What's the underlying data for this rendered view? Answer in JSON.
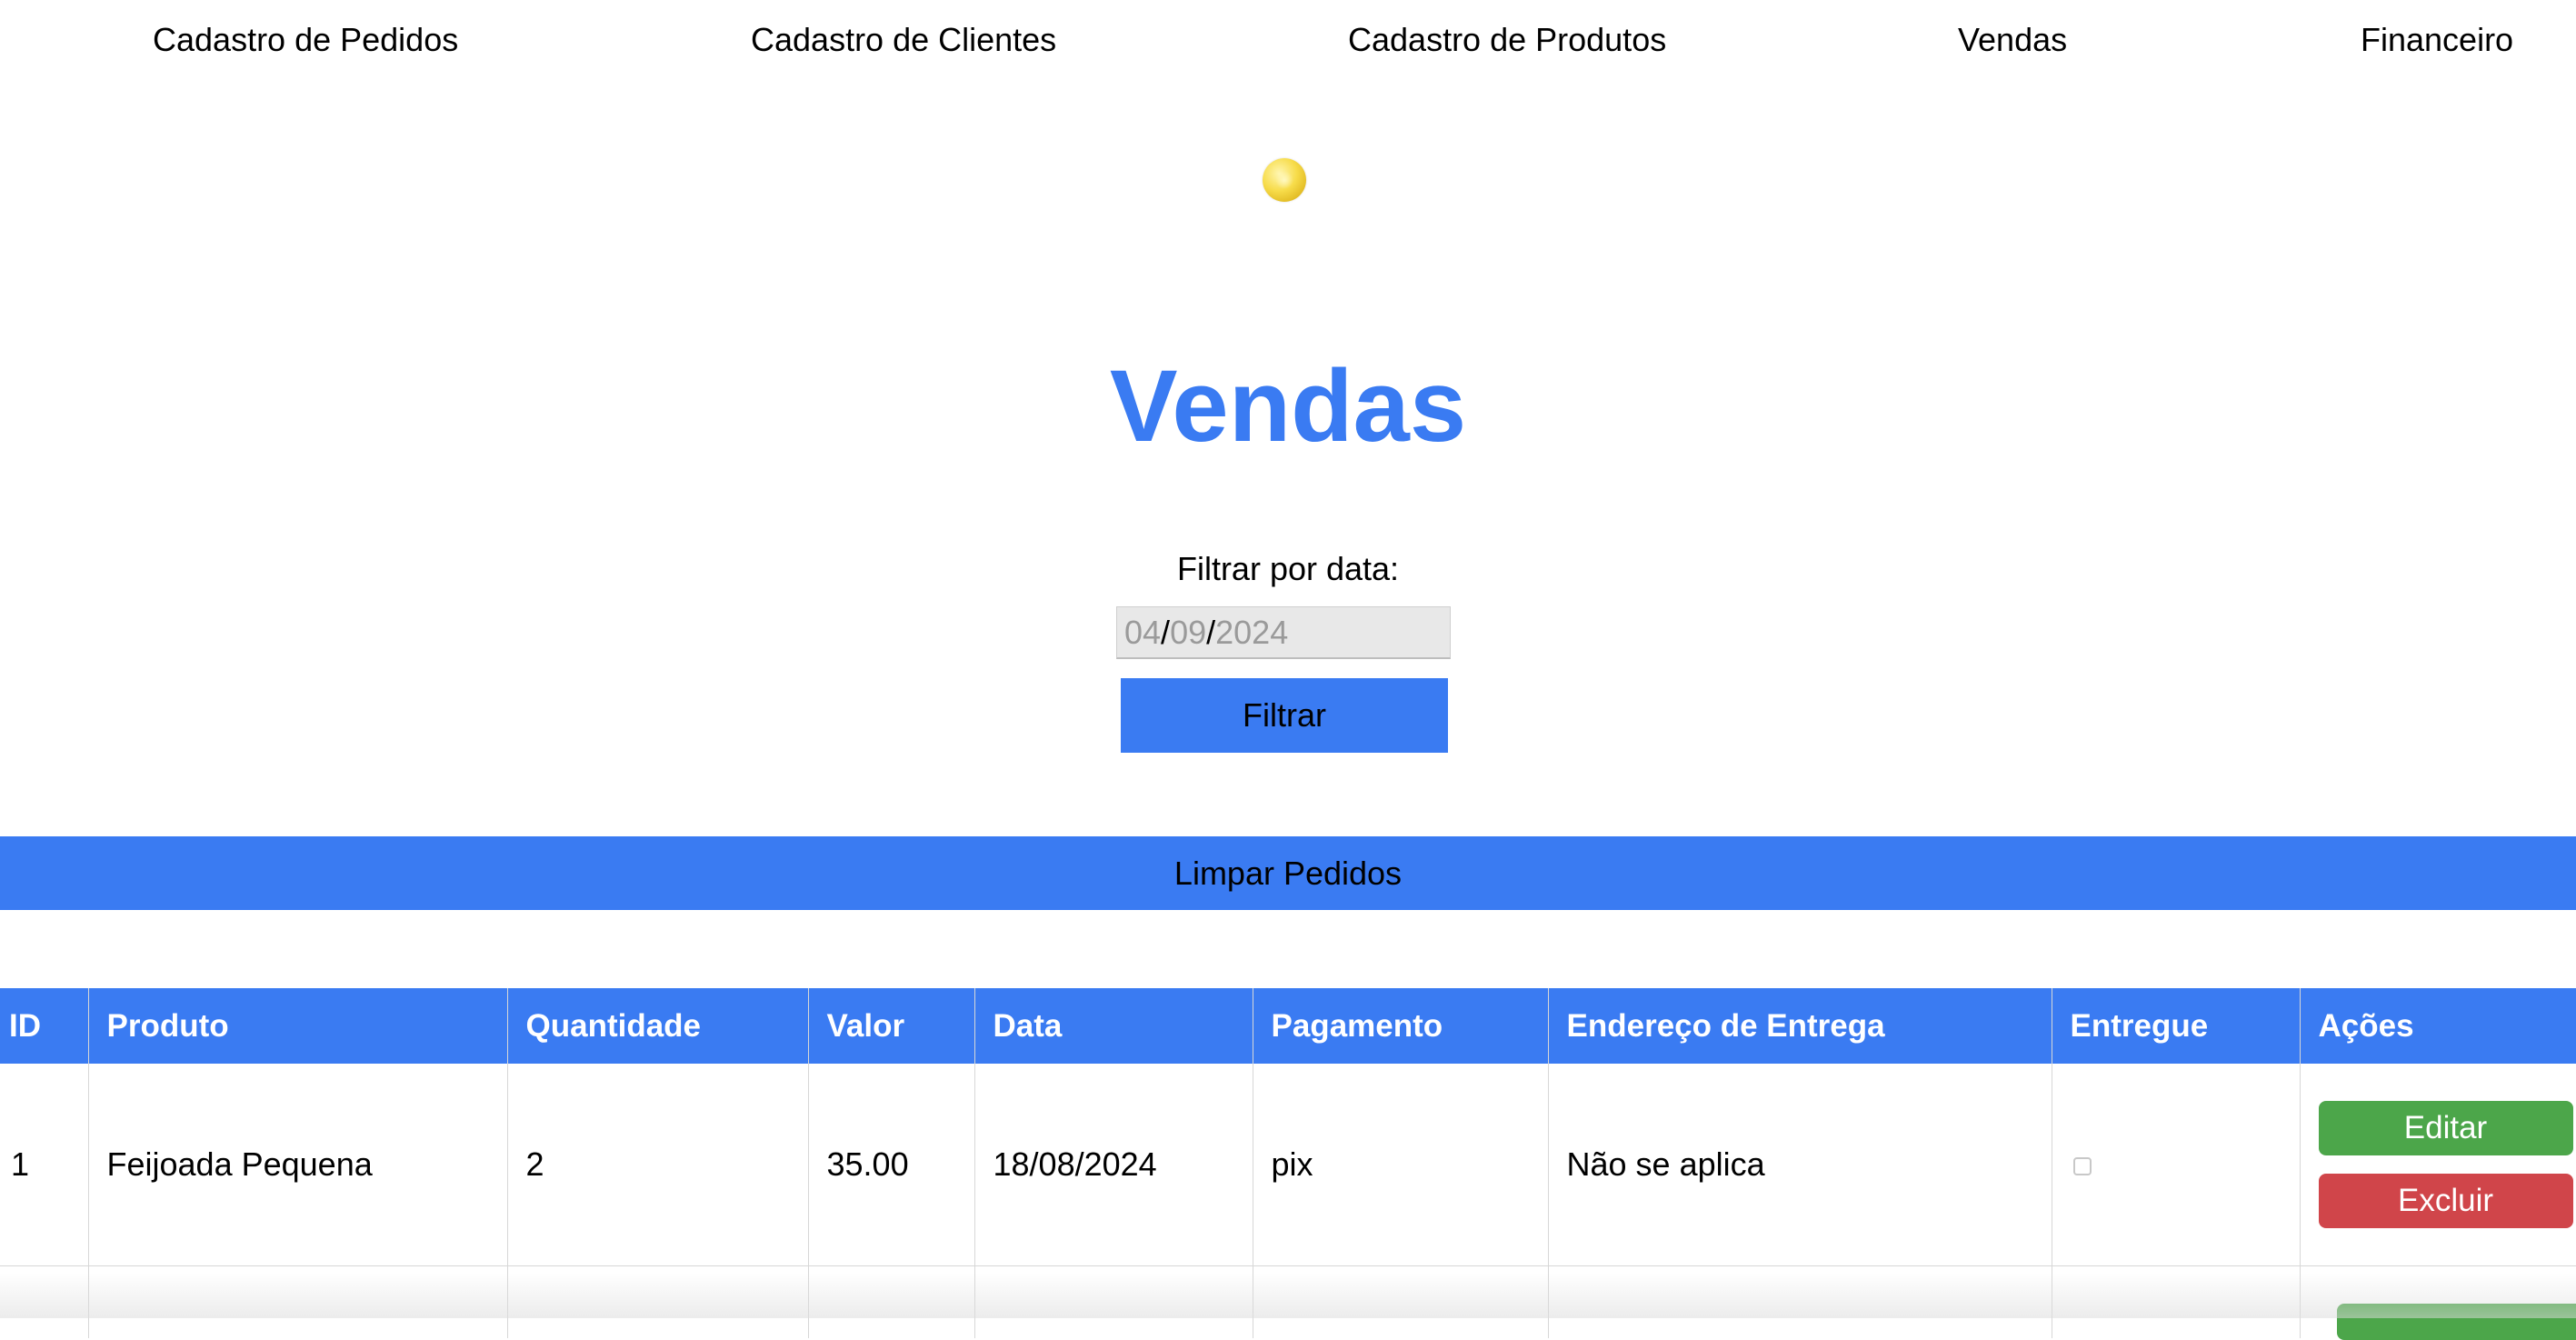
{
  "nav": {
    "items": [
      {
        "label": "Cadastro de Pedidos"
      },
      {
        "label": "Cadastro de Clientes"
      },
      {
        "label": "Cadastro de Produtos"
      },
      {
        "label": "Vendas"
      },
      {
        "label": "Financeiro"
      }
    ]
  },
  "header": {
    "theme_icon": "moon-icon",
    "title": "Vendas"
  },
  "filter": {
    "label": "Filtrar por data:",
    "date_day": "04",
    "date_month": "09",
    "date_year": "2024",
    "separator": "/",
    "button_label": "Filtrar"
  },
  "clear_button_label": "Limpar Pedidos",
  "table": {
    "headers": [
      "ID",
      "Produto",
      "Quantidade",
      "Valor",
      "Data",
      "Pagamento",
      "Endereço de Entrega",
      "Entregue",
      "Ações"
    ],
    "rows": [
      {
        "id": "1",
        "produto": "Feijoada Pequena",
        "quantidade": "2",
        "valor": "35.00",
        "data": "18/08/2024",
        "pagamento": "pix",
        "endereco": "Não se aplica",
        "entregue": false,
        "edit_label": "Editar",
        "delete_label": "Excluir"
      }
    ]
  },
  "colors": {
    "accent": "#3a7bf2",
    "edit": "#4ca64a",
    "delete": "#d0454a"
  }
}
